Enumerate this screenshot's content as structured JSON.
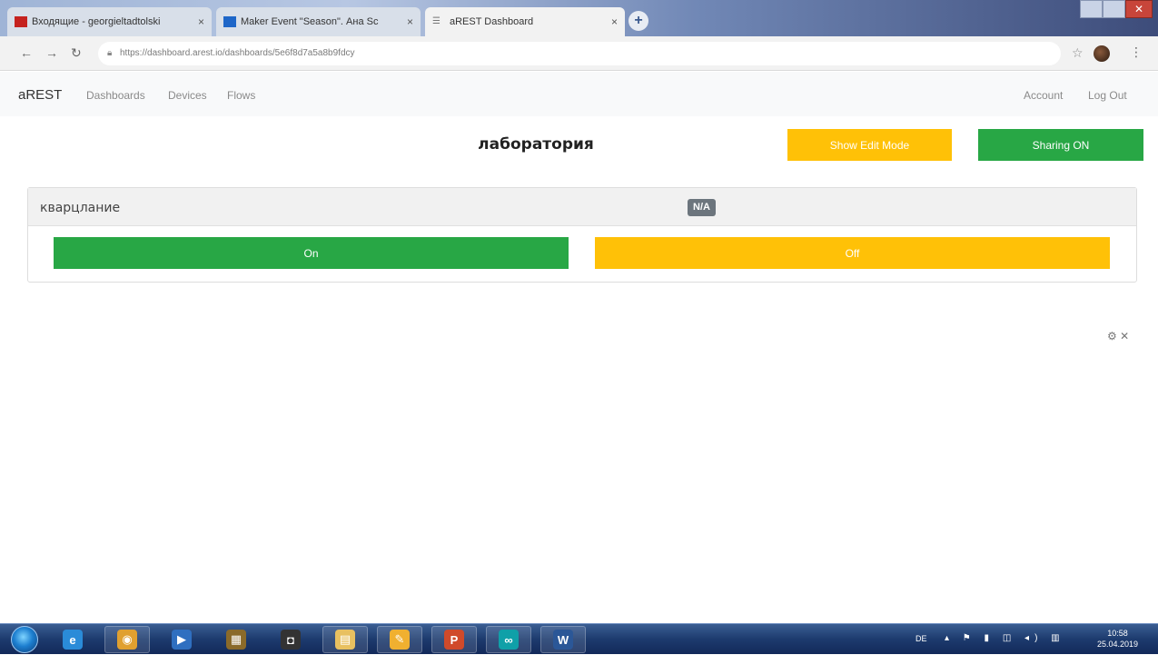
{
  "browser": {
    "tabs": [
      {
        "label": "Входящие - georgieltadtolski",
        "favicon_color": "#c5221f",
        "active": false
      },
      {
        "label": "Maker Event \"Season\". Ана Sc",
        "favicon_color": "#1e66c8",
        "active": false
      },
      {
        "label": "aREST Dashboard",
        "favicon_color": "#777777",
        "active": true
      }
    ],
    "tab_close_glyph": "×",
    "new_tab_glyph": "+",
    "url": "https://dashboard.arest.io/dashboards/5e6f8d7a5a8b9fdcy",
    "window_close_glyph": "✕"
  },
  "app": {
    "brand": "aREST",
    "nav": {
      "dashboards": "Dashboards",
      "devices": "Devices",
      "flows": "Flows",
      "account": "Account",
      "logout": "Log Out"
    },
    "dashboard_title": "лаборатория",
    "show_edit_mode_label": "Show Edit Mode",
    "sharing_label": "Sharing ON",
    "panel": {
      "title": "кварцлание",
      "badge": "N/A",
      "on_label": "On",
      "off_label": "Off"
    },
    "mini_tools": "⚙ ✕"
  },
  "colors": {
    "success": "#28a745",
    "warning": "#ffc107",
    "badge": "#6c757d"
  },
  "taskbar": {
    "items": [
      {
        "icon": "ie-icon",
        "glyph": "e",
        "color": "#2a8bd8",
        "pinned": false
      },
      {
        "icon": "chrome-icon",
        "glyph": "◉",
        "color": "#e0a030",
        "pinned": true
      },
      {
        "icon": "media-player-icon",
        "glyph": "▶",
        "color": "#2f6fc0",
        "pinned": false
      },
      {
        "icon": "winrar-icon",
        "glyph": "▦",
        "color": "#8a6a2a",
        "pinned": false
      },
      {
        "icon": "webcam-icon",
        "glyph": "◘",
        "color": "#333333",
        "pinned": false
      },
      {
        "icon": "explorer-icon",
        "glyph": "▤",
        "color": "#e8c060",
        "pinned": true
      },
      {
        "icon": "paint-icon",
        "glyph": "✎",
        "color": "#f0b030",
        "pinned": true
      },
      {
        "icon": "powerpoint-icon",
        "glyph": "P",
        "color": "#d04a2a",
        "pinned": true
      },
      {
        "icon": "arduino-icon",
        "glyph": "∞",
        "color": "#10a0a8",
        "pinned": true
      },
      {
        "icon": "word-icon",
        "glyph": "W",
        "color": "#2b5797",
        "pinned": true
      }
    ],
    "tray": {
      "lang": "DE",
      "icons": "▴ ⚑ ▮ ◫ ◂) ▥",
      "time": "10:58",
      "date": "25.04.2019"
    }
  }
}
